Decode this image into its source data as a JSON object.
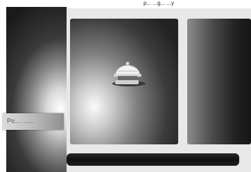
{
  "window": {
    "title": "p... ...g... ...y"
  },
  "sidebar": {
    "selected_label": "Po.... ......"
  },
  "preview": {
    "icon": "rotary-device-icon"
  },
  "progress": {
    "value": 0
  }
}
